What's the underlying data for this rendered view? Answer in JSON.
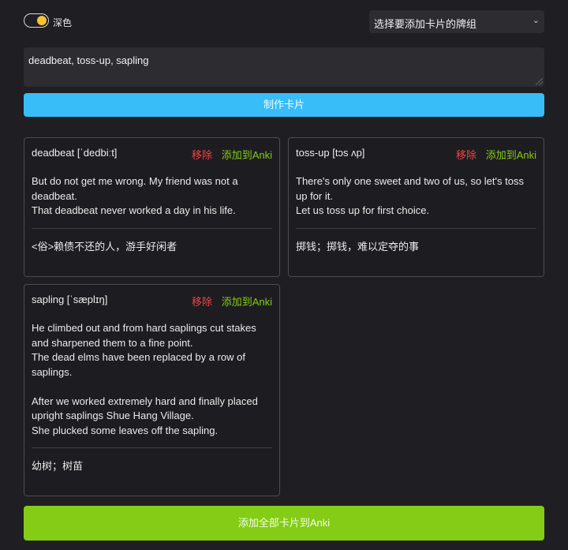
{
  "header": {
    "theme_label": "深色",
    "deck_select": {
      "selected": "选择要添加卡片的牌组"
    }
  },
  "input": {
    "value": "deadbeat, toss-up, sapling"
  },
  "make_button": "制作卡片",
  "card_actions": {
    "remove": "移除",
    "add": "添加到Anki"
  },
  "cards": [
    {
      "word": "deadbeat [ˈdedbiːt]",
      "examples": [
        "But do not get me wrong. My friend was not a deadbeat.",
        "That deadbeat never worked a day in his life."
      ],
      "meaning": "<俗>赖债不还的人，游手好闲者"
    },
    {
      "word": "toss-up [tɔs ʌp]",
      "examples": [
        "There's only one sweet and two of us, so let's toss up for it.",
        "Let us toss up for first choice."
      ],
      "meaning": "掷钱；掷钱，难以定夺的事"
    },
    {
      "word": "sapling [ˈsæplɪŋ]",
      "examples": [
        "He climbed out and from hard saplings cut stakes and sharpened them to a fine point.",
        "The dead elms have been replaced by a row of saplings.",
        "",
        "After we worked extremely hard and finally placed upright saplings Shue Hang Village.",
        "She plucked some leaves off the sapling."
      ],
      "meaning": "幼树；树苗"
    }
  ],
  "add_all_button": "添加全部卡片到Anki",
  "colors": {
    "background": "#1f1f23",
    "primary": "#38bdf8",
    "success": "#84cc16",
    "danger": "#ef4444",
    "toggle": "#f6c333"
  }
}
